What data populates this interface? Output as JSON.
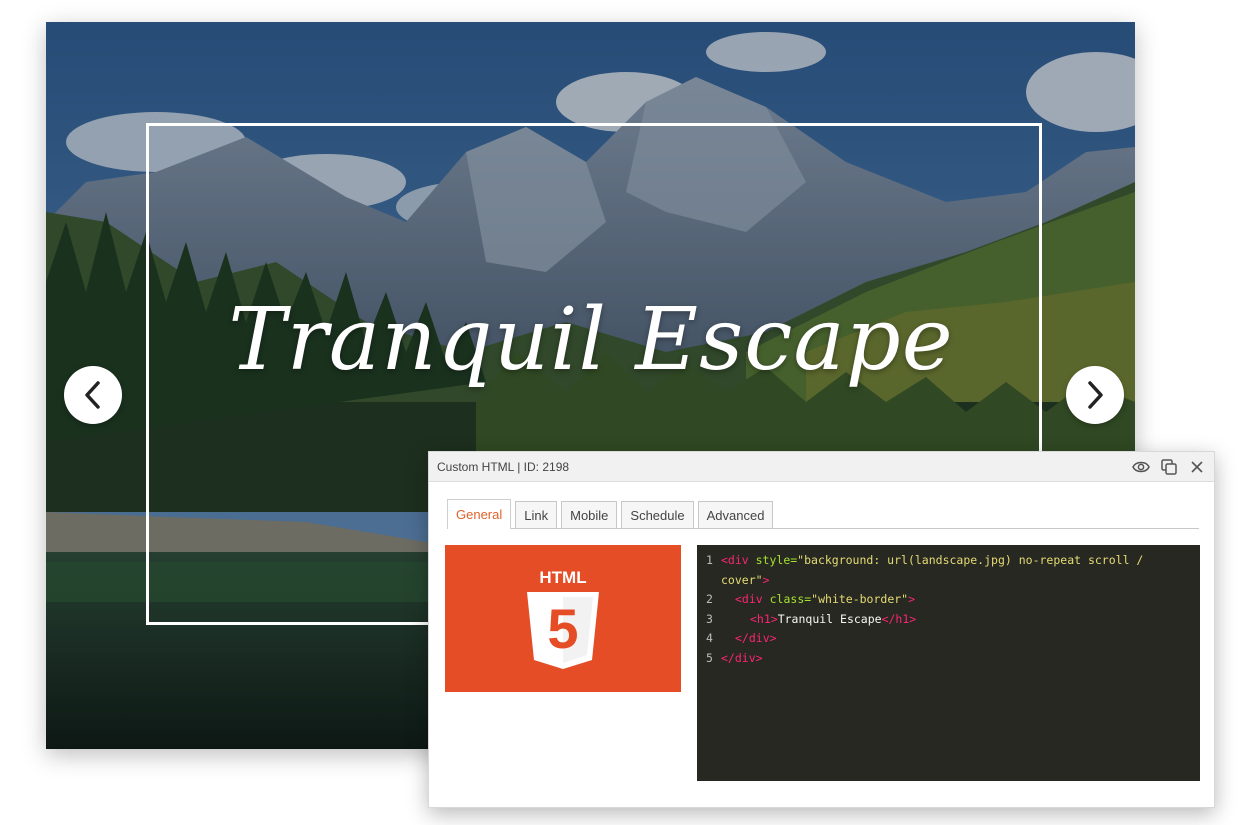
{
  "slider": {
    "title": "Tranquil Escape",
    "prev_icon": "chevron-left-icon",
    "next_icon": "chevron-right-icon"
  },
  "panel": {
    "title": "Custom HTML | ID: 2198",
    "icons": [
      "eye-icon",
      "duplicate-icon",
      "close-icon"
    ],
    "tabs": [
      {
        "label": "General",
        "active": true
      },
      {
        "label": "Link",
        "active": false
      },
      {
        "label": "Mobile",
        "active": false
      },
      {
        "label": "Schedule",
        "active": false
      },
      {
        "label": "Advanced",
        "active": false
      }
    ],
    "html_logo_text": "HTML",
    "html_logo_digit": "5",
    "code": {
      "line_numbers": [
        "1",
        "2",
        "3",
        "4",
        "5"
      ],
      "line1_tag_open": "<div ",
      "line1_attr": "style=",
      "line1_str_a": "\"background: url(landscape.jpg) no-repeat scroll /",
      "line1_str_b": "cover\"",
      "line1_close": ">",
      "line2_tag_open": "<div ",
      "line2_attr": "class=",
      "line2_str": "\"white-border\"",
      "line2_close": ">",
      "line3_open": "<h1>",
      "line3_text": "Tranquil Escape",
      "line3_close": "</h1>",
      "line4": "</div>",
      "line5": "</div>"
    }
  },
  "colors": {
    "accent": "#e0622b",
    "html5": "#e44d26",
    "editor_bg": "#272822"
  }
}
